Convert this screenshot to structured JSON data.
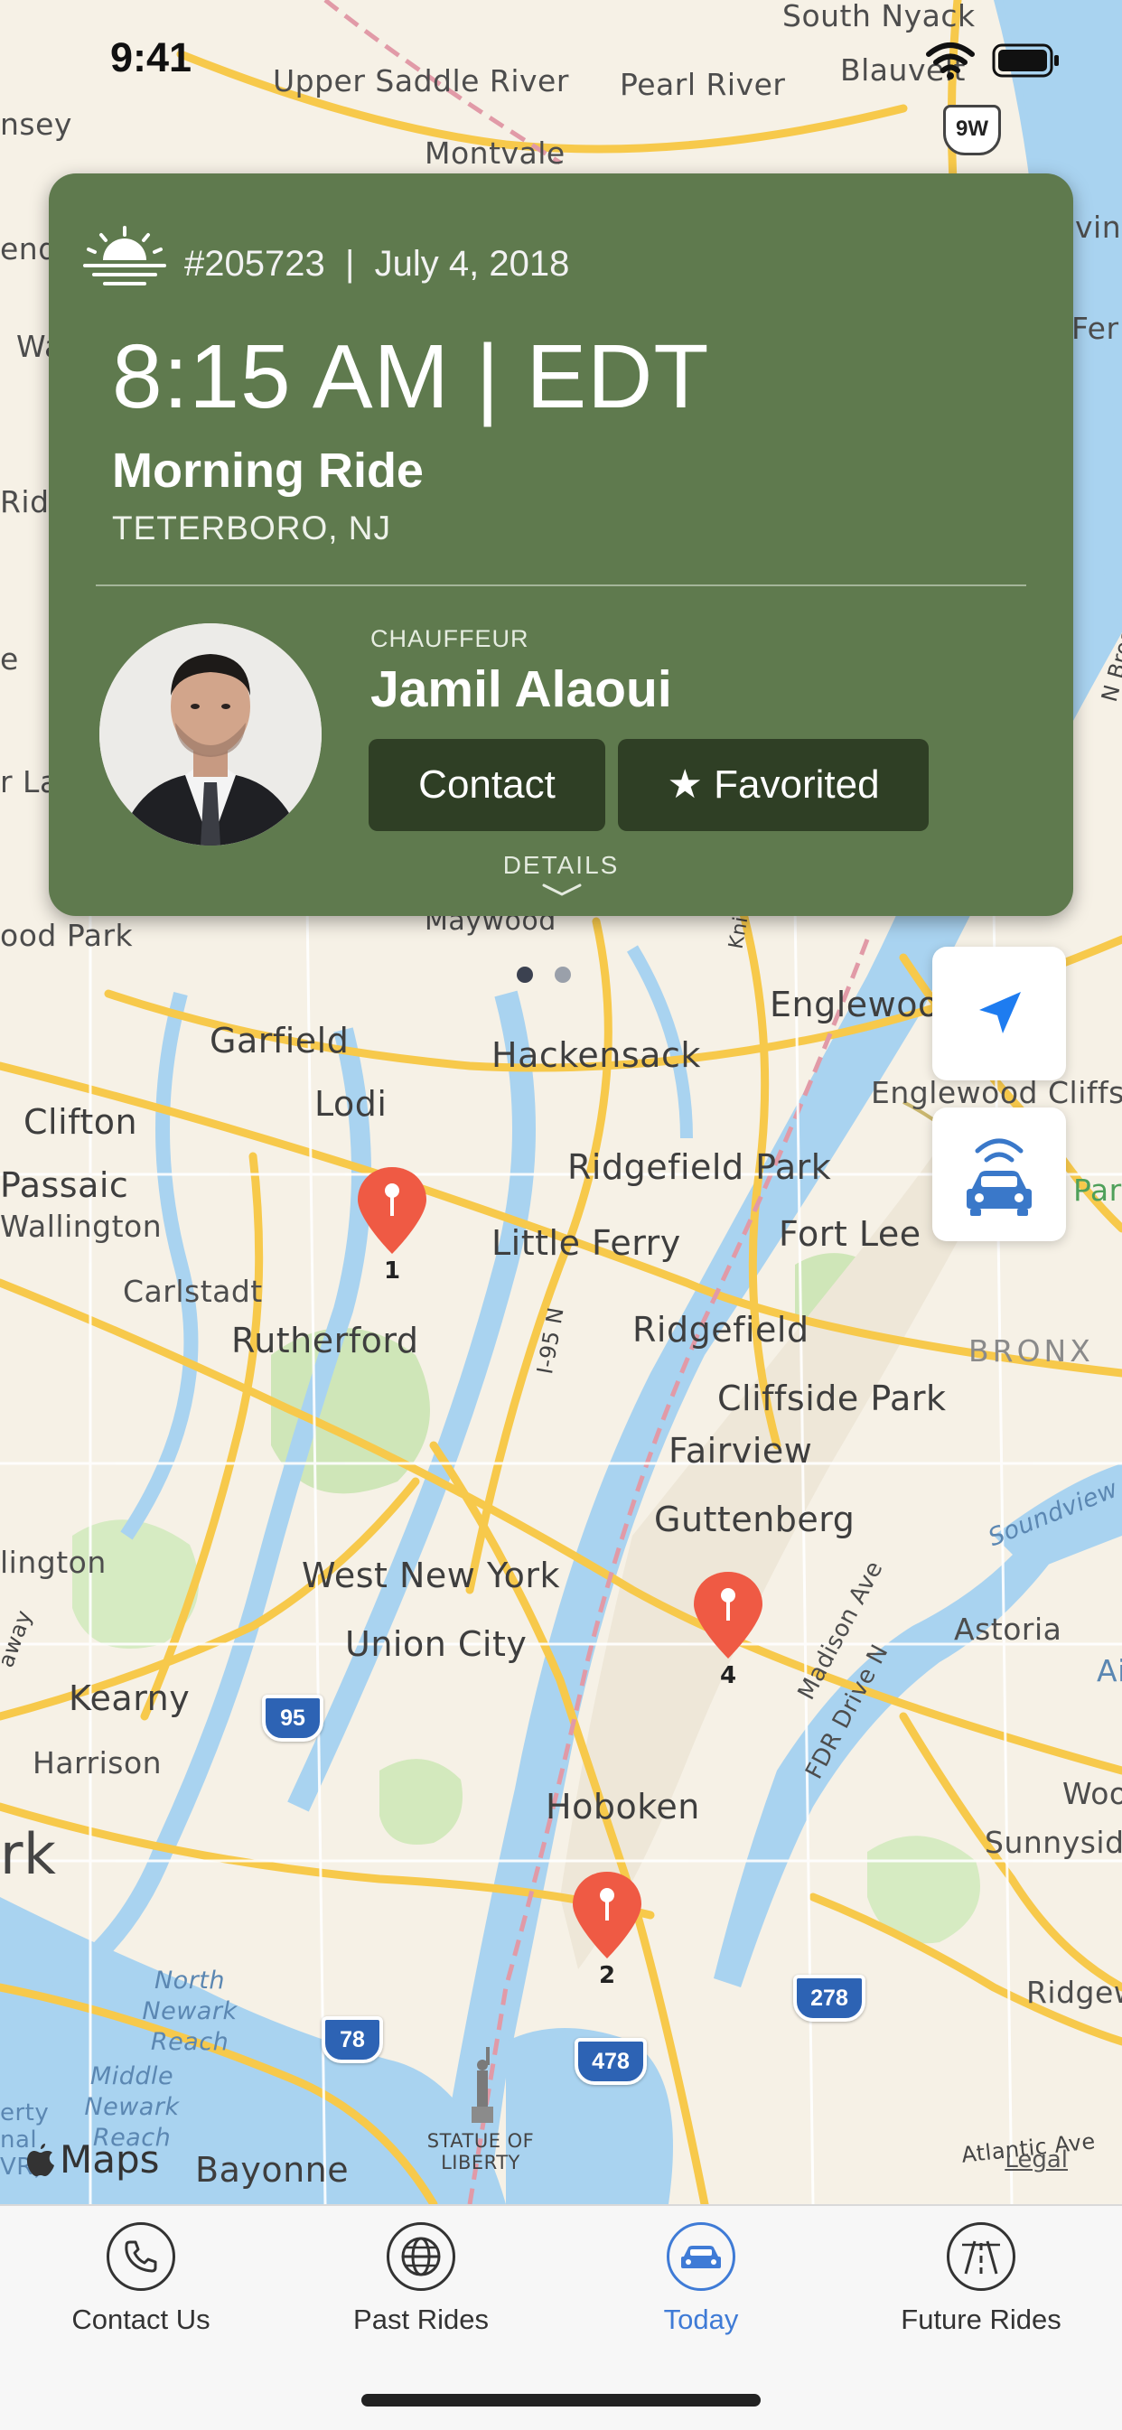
{
  "status_bar": {
    "time": "9:41"
  },
  "map": {
    "labels": {
      "south_nyack": "South Nyack",
      "upper_saddle_river": "Upper Saddle River",
      "pearl_river": "Pearl River",
      "blauvelt": "Blauvelt",
      "montvale": "Montvale",
      "maywood": "Maywood",
      "elmwood_park": "ood Park",
      "englewood": "Englewood",
      "englewood_cliffs": "Englewood Cliffs",
      "garfield": "Garfield",
      "hackensack": "Hackensack",
      "lodi": "Lodi",
      "clifton": "Clifton",
      "ridgefield_park": "Ridgefield Park",
      "passaic": "Passaic",
      "wallington": "Wallington",
      "little_ferry": "Little Ferry",
      "fort_lee": "Fort Lee",
      "carlstadt": "Carlstadt",
      "rutherford": "Rutherford",
      "ridgefield": "Ridgefield",
      "bronx": "BRONX",
      "cliffside_park": "Cliffside Park",
      "fairview": "Fairview",
      "guttenberg": "Guttenberg",
      "west_new_york": "West New York",
      "union_city": "Union City",
      "astoria": "Astoria",
      "kearny": "Kearny",
      "harrison": "Harrison",
      "hoboken": "Hoboken",
      "sunnyside": "Sunnysid",
      "woodside": "Woo",
      "newark": "rk",
      "ridgewood": "Ridgew",
      "bayonne": "Bayonne",
      "north_newark_reach": "North Newark Reach",
      "middle_newark_reach": "Middle Newark Reach",
      "statue_of_liberty": "STATUE OF LIBERTY",
      "atlantic_ave": "Atlantic Ave",
      "madison_ave": "Madison Ave",
      "fdr_drive": "FDR Drive N",
      "i95n": "I-95 N",
      "soundview": "Soundview",
      "lington": "lington",
      "nsey": "nsey",
      "end": "end",
      "wa": "Wa",
      "rid": "Rid",
      "e_left": "e",
      "l_left": "r La",
      "kni": "Kni",
      "ving": "ving",
      "fer": "Fer",
      "n_broadway": "N Broadway",
      "par": "Par",
      "ai": "Ai",
      "away": "away",
      "erty": "erty",
      "nal": "nal",
      "vr": "VR)"
    },
    "shields": {
      "us9w": "9W",
      "i95": "95",
      "i278": "278",
      "i78": "78",
      "i478": "478"
    },
    "pins": [
      "1",
      "2",
      "4"
    ],
    "maps_brand": "Maps",
    "legal": "Legal"
  },
  "ride_card": {
    "ride_number": "#205723",
    "date": "July 4, 2018",
    "time": "8:15 AM | EDT",
    "title": "Morning Ride",
    "location": "TETERBORO, NJ",
    "chauffeur_label": "CHAUFFEUR",
    "chauffeur_name": "Jamil Alaoui",
    "contact_label": "Contact",
    "favorited_label": "★ Favorited",
    "details_label": "DETAILS",
    "background_color": "#5f7a4e",
    "button_color": "#2f3f25"
  },
  "tabs": [
    {
      "label": "Contact Us",
      "icon": "phone-icon"
    },
    {
      "label": "Past Rides",
      "icon": "globe-icon"
    },
    {
      "label": "Today",
      "icon": "car-icon"
    },
    {
      "label": "Future Rides",
      "icon": "road-icon"
    }
  ],
  "accent_color": "#3f7bd6"
}
